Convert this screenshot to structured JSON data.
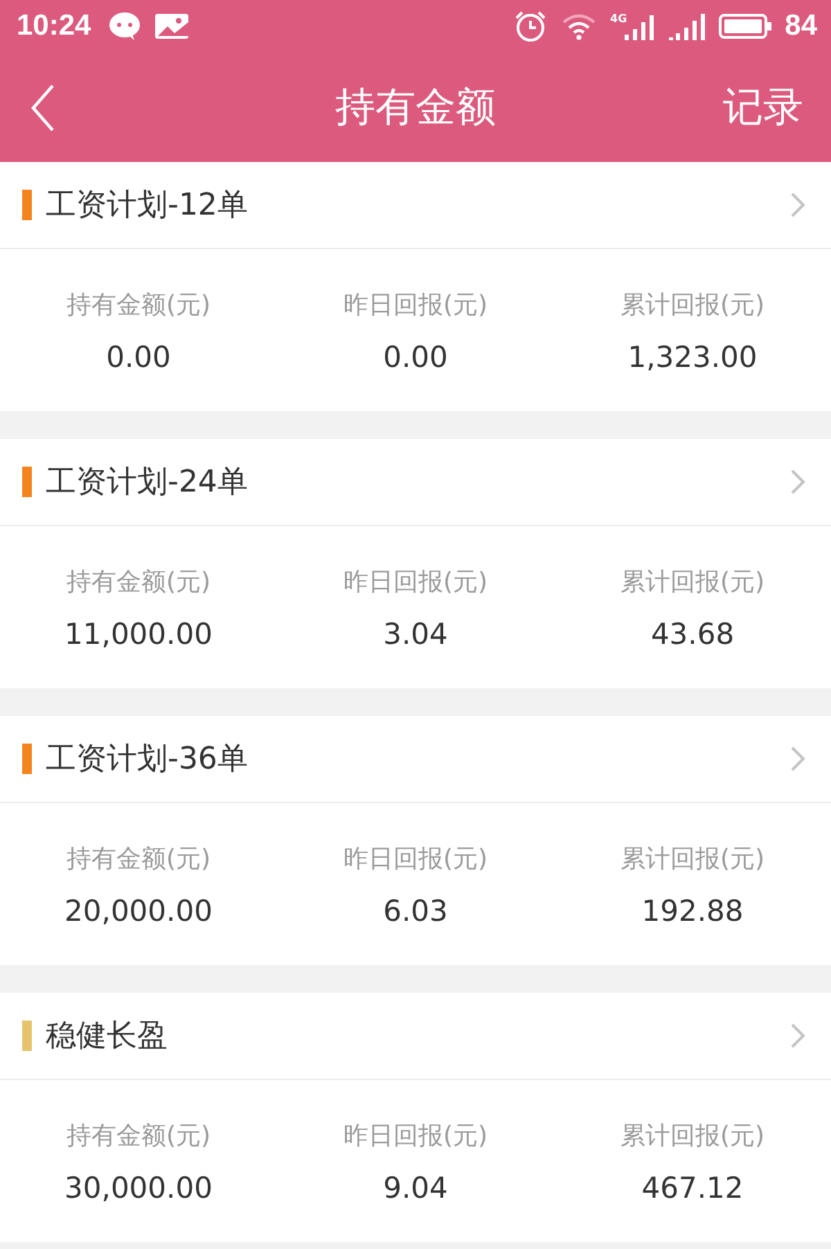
{
  "status_bar": {
    "time": "10:24",
    "network": "4G",
    "battery": "84"
  },
  "header": {
    "title": "持有金额",
    "action": "记录"
  },
  "products": [
    {
      "name": "工资计划-12单",
      "color": "#f5841f",
      "stats": [
        {
          "label": "持有金额(元)",
          "value": "0.00"
        },
        {
          "label": "昨日回报(元)",
          "value": "0.00"
        },
        {
          "label": "累计回报(元)",
          "value": "1,323.00"
        }
      ]
    },
    {
      "name": "工资计划-24单",
      "color": "#f5841f",
      "stats": [
        {
          "label": "持有金额(元)",
          "value": "11,000.00"
        },
        {
          "label": "昨日回报(元)",
          "value": "3.04"
        },
        {
          "label": "累计回报(元)",
          "value": "43.68"
        }
      ]
    },
    {
      "name": "工资计划-36单",
      "color": "#f5841f",
      "stats": [
        {
          "label": "持有金额(元)",
          "value": "20,000.00"
        },
        {
          "label": "昨日回报(元)",
          "value": "6.03"
        },
        {
          "label": "累计回报(元)",
          "value": "192.88"
        }
      ]
    },
    {
      "name": "稳健长盈",
      "color": "#e8c36e",
      "stats": [
        {
          "label": "持有金额(元)",
          "value": "30,000.00"
        },
        {
          "label": "昨日回报(元)",
          "value": "9.04"
        },
        {
          "label": "累计回报(元)",
          "value": "467.12"
        }
      ]
    }
  ]
}
